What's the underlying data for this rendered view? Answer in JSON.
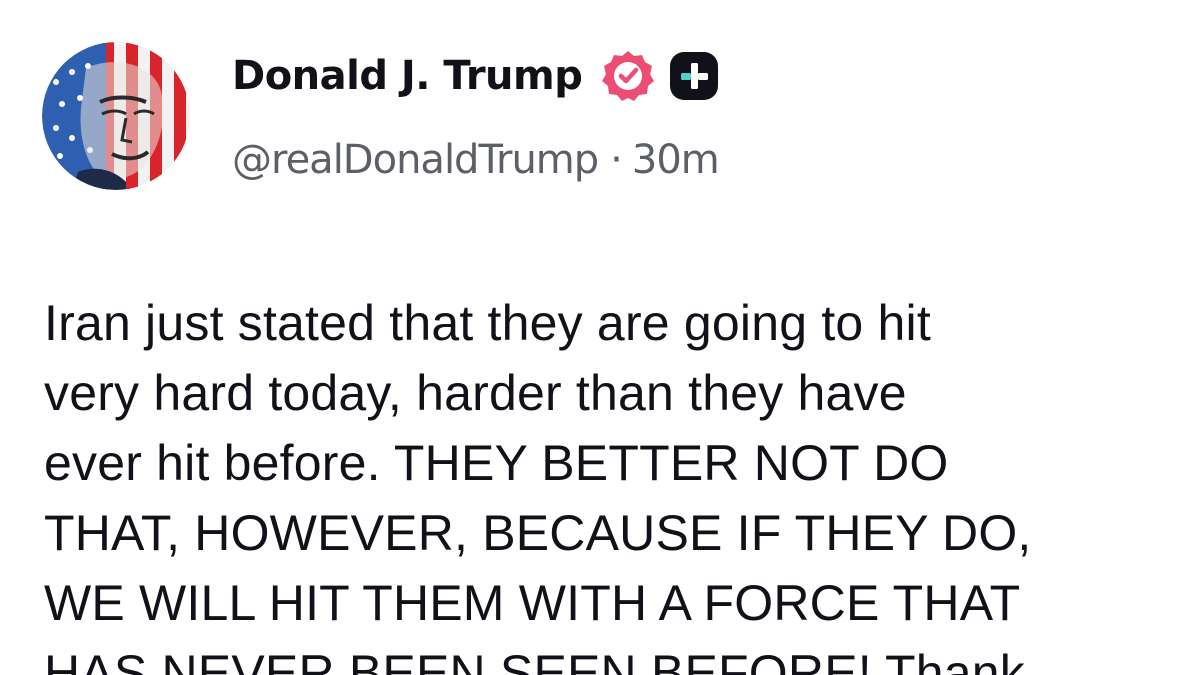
{
  "post": {
    "author": {
      "display_name": "Donald J. Trump",
      "handle": "@realDonaldTrump",
      "separator": "·",
      "time_ago": "30m",
      "avatar_icon": "avatar-flag-portrait",
      "verified_icon": "verified-badge-icon",
      "verified_color": "#ee4d73",
      "plus_icon": "plus-badge-icon",
      "plus_color": "#111119",
      "plus_accent": "#4fd1c5"
    },
    "body_lines": [
      "Iran just stated that they are going to hit",
      "very hard today, harder than they have",
      "ever hit before. THEY BETTER NOT DO",
      "THAT, HOWEVER, BECAUSE IF THEY DO,",
      "WE WILL HIT THEM WITH A FORCE THAT",
      "HAS NEVER BEEN SEEN BEFORE! Thank"
    ]
  }
}
